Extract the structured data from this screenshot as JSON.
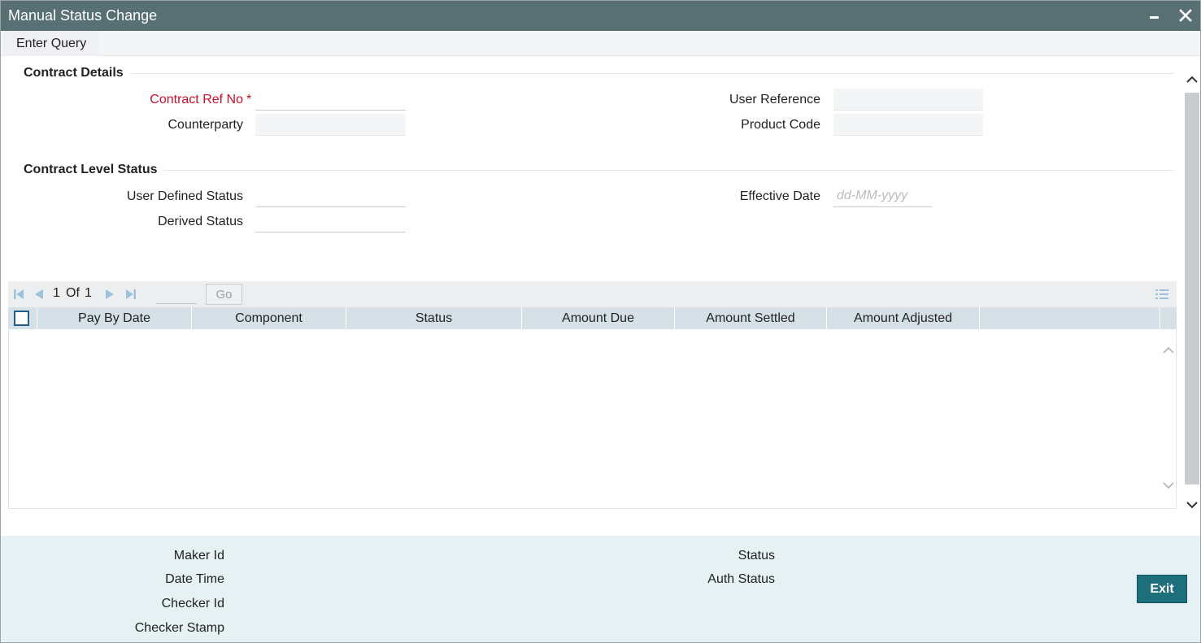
{
  "window": {
    "title": "Manual Status Change"
  },
  "menu": {
    "enter_query": "Enter Query"
  },
  "contract_details": {
    "section_title": "Contract Details",
    "contract_ref_no": {
      "label": "Contract Ref No",
      "required_mark": "*",
      "value": ""
    },
    "counterparty": {
      "label": "Counterparty",
      "value": ""
    },
    "user_reference": {
      "label": "User Reference",
      "value": ""
    },
    "product_code": {
      "label": "Product Code",
      "value": ""
    }
  },
  "contract_level_status": {
    "section_title": "Contract Level Status",
    "user_defined_status": {
      "label": "User Defined Status",
      "value": ""
    },
    "derived_status": {
      "label": "Derived Status",
      "value": ""
    },
    "effective_date": {
      "label": "Effective Date",
      "value": "",
      "placeholder": "dd-MM-yyyy"
    }
  },
  "grid": {
    "pagination": {
      "current": "1",
      "of_label": "Of",
      "total": "1",
      "go_label": "Go",
      "page_input": ""
    },
    "columns": [
      "Pay By Date",
      "Component",
      "Status",
      "Amount Due",
      "Amount Settled",
      "Amount Adjusted"
    ],
    "rows": []
  },
  "footer": {
    "maker_id": "Maker Id",
    "date_time": "Date Time",
    "checker_id": "Checker Id",
    "checker_stamp": "Checker Stamp",
    "status": "Status",
    "auth_status": "Auth Status",
    "exit_label": "Exit"
  },
  "icons": {
    "minimize": "minimize-icon",
    "close": "close-icon",
    "first_page": "first-page-icon",
    "prev_page": "prev-page-icon",
    "next_page": "next-page-icon",
    "last_page": "last-page-icon",
    "column_list": "list-icon"
  },
  "colors": {
    "titlebar": "#587074",
    "required": "#c8102e",
    "grid_header": "#d5e1e6",
    "footer": "#e6f1f4",
    "exit_button": "#1d6f7c"
  }
}
